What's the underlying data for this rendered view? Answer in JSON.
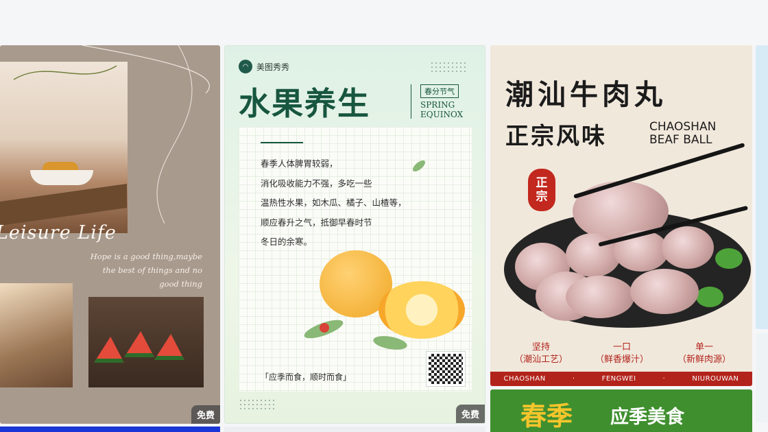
{
  "cards": [
    {
      "title": "Leisure Life",
      "quote": "Hope is a good thing,maybe the best of things and no good thing",
      "badge": "免费"
    },
    {
      "brand": "美图秀秀",
      "headline": "水果养生",
      "tag": "春分节气",
      "tag_en_1": "SPRING",
      "tag_en_2": "EQUINOX",
      "body_lines": [
        "春季人体脾胃较弱，",
        "消化吸收能力不强，多吃一些",
        "温热性水果，如木瓜、橘子、山楂等，",
        "顺应春升之气，抵御早春时节",
        "冬日的余寒。"
      ],
      "footer": "「应季而食，顺时而食」",
      "badge": "免费"
    },
    {
      "title_1": "潮汕牛肉丸",
      "title_2": "正宗风味",
      "title_en_1": "CHAOSHAN",
      "title_en_2": "BEAF BALL",
      "stamp_1": "正",
      "stamp_2": "宗",
      "features": [
        {
          "l1": "坚持",
          "l2": "（潮汕工艺）"
        },
        {
          "l1": "一口",
          "l2": "（鲜香爆汁）"
        },
        {
          "l1": "单一",
          "l2": "（新鲜肉源）"
        }
      ],
      "bar_items": [
        "CHAOSHAN",
        "·",
        "FENGWEI",
        "·",
        "NIUROUWAN"
      ]
    },
    {
      "title_big": "春季",
      "title_small": "应季美食"
    }
  ],
  "colors": {
    "accent_green": "#17563f",
    "accent_red": "#b2231b",
    "badge_bg": "#464646"
  }
}
